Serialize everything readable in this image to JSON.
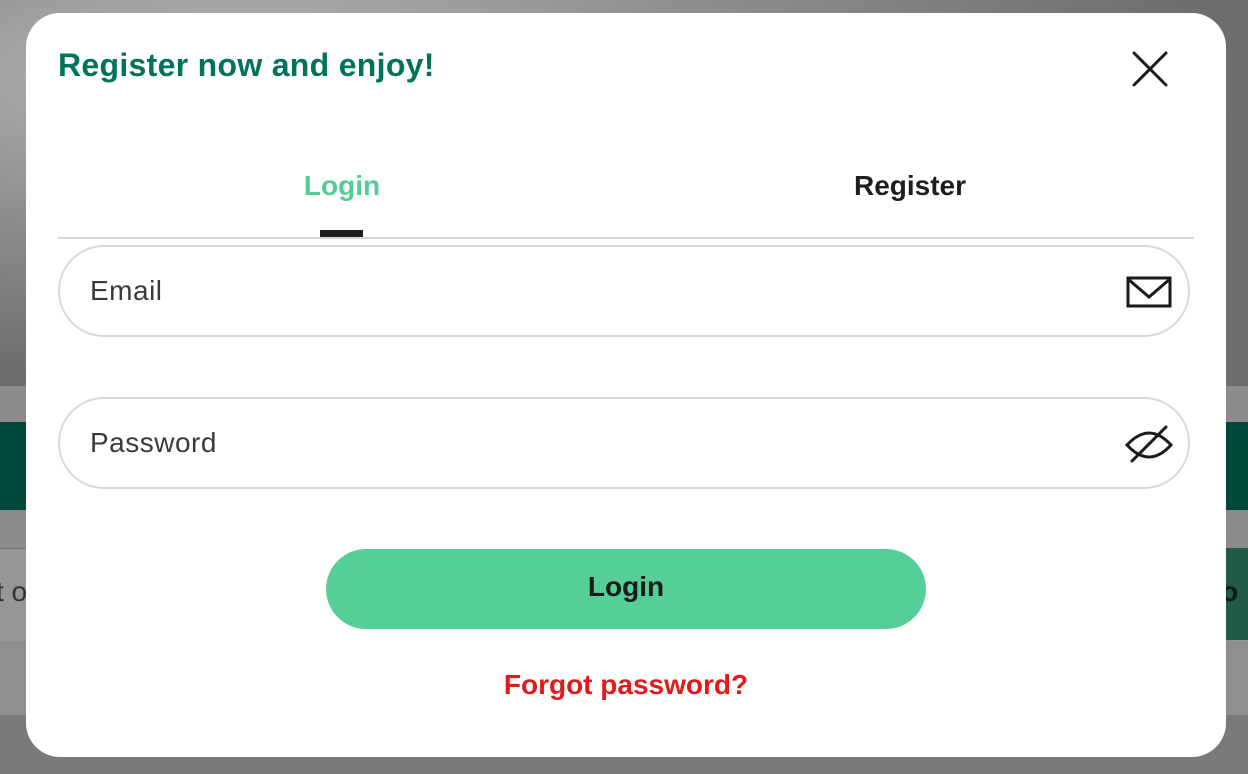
{
  "background": {
    "row_text": "t o",
    "row_button": "go"
  },
  "modal": {
    "title": "Register now and enjoy!",
    "close_icon": "close-icon"
  },
  "tabs": [
    {
      "label": "Login",
      "active": true
    },
    {
      "label": "Register",
      "active": false
    }
  ],
  "form": {
    "email_placeholder": "Email",
    "email_icon": "envelope-icon",
    "password_placeholder": "Password",
    "password_icon": "eye-slash-icon",
    "submit_label": "Login",
    "forgot_label": "Forgot password?"
  },
  "colors": {
    "title": "#00735a",
    "accent": "#55cf97",
    "active_tab": "#55cc96",
    "forgot": "#e21a1a"
  }
}
